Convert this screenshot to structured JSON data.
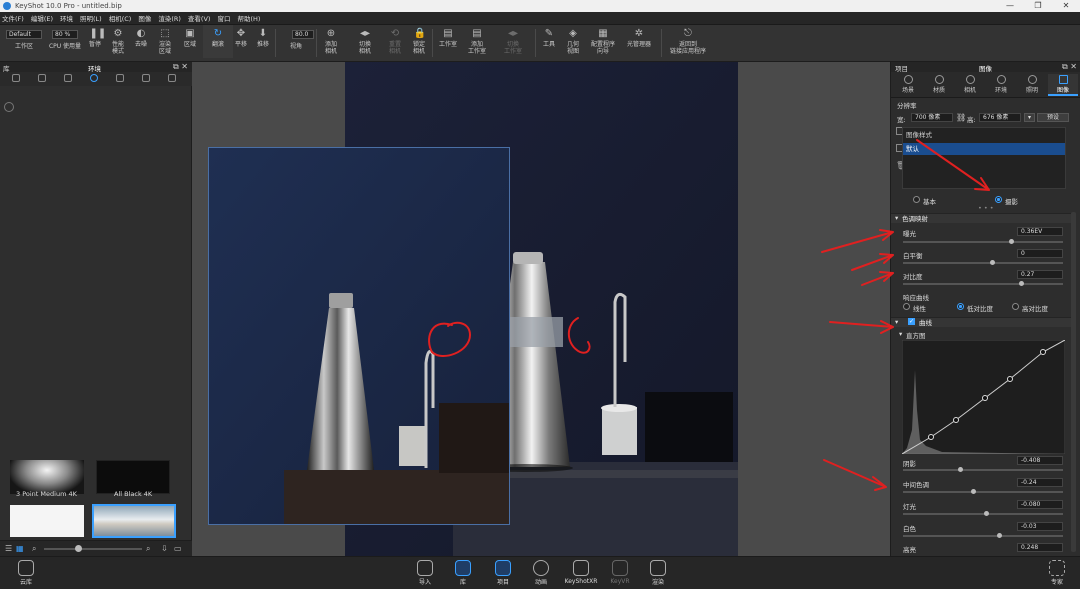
{
  "window": {
    "title": "KeyShot 10.0 Pro  - untitled.bip",
    "controls": [
      "—",
      "❐",
      "✕"
    ]
  },
  "menu": [
    "文件(F)",
    "编辑(E)",
    "环境",
    "照明(L)",
    "相机(C)",
    "图像",
    "渲染(R)",
    "查看(V)",
    "窗口",
    "帮助(H)"
  ],
  "toolbar": {
    "preset": "Default",
    "cpu_pct": "80 %",
    "fov": "80.0",
    "buttons": [
      "工作区",
      "CPU 使用量",
      "暂停",
      "性能\n模式",
      "去噪",
      "渲染\n区域",
      "区域",
      "翻滚",
      "平移",
      "推移",
      "视角",
      "添加\n相机",
      "切换\n相机",
      "重置\n相机",
      "锁定\n相机",
      "工作室",
      "添加\n工作室",
      "切换\n工作室",
      "工具",
      "几何\n视图",
      "配置程序\n向导",
      "光管理器",
      "返回到\n链接应用程序"
    ]
  },
  "left_panel": {
    "title": "库",
    "center_title": "环境",
    "thumbs": [
      {
        "label": "3 Point Medium 4K"
      },
      {
        "label": "All Black 4K"
      }
    ]
  },
  "right_panel": {
    "title": "项目",
    "center_title": "图像",
    "tabs": [
      "场景",
      "材质",
      "相机",
      "环境",
      "照明",
      "图像"
    ],
    "active_tab": "图像",
    "resolution_label": "分辨率",
    "width_label": "宽:",
    "width_value": "700 像素",
    "height_label": "高:",
    "height_value": "676 像素",
    "preset_button": "预设",
    "image_styles": [
      "图像样式",
      "默认"
    ],
    "mode_basic": "基本",
    "mode_photo": "摄影",
    "tone_mapping": "色调映射",
    "exposure_label": "曝光",
    "exposure_value": "0.36EV",
    "exposure_level": 0.68,
    "white_balance_label": "白平衡",
    "white_balance_value": "0",
    "white_balance_level": 0.56,
    "contrast_label": "对比度",
    "contrast_value": "0.27",
    "contrast_level": 0.74,
    "response_curve_label": "响应曲线",
    "curve_linear": "线性",
    "curve_low": "低对比度",
    "curve_high": "高对比度",
    "curves_section": "曲线",
    "histogram_label": "直方图",
    "shadows_label": "阴影",
    "shadows_value": "-0.408",
    "shadows_level": 0.36,
    "midtones_label": "中间色调",
    "midtones_value": "-0.24",
    "midtones_level": 0.44,
    "highlights_label": "灯光",
    "highlights_value": "-0.080",
    "highlights_level": 0.52,
    "whites_label": "白色",
    "whites_value": "-0.03",
    "whites_level": 0.6,
    "highs_label": "高亮",
    "highs_value": "0.248",
    "highs_level": 0.66
  },
  "bottom": {
    "cloud": "云库",
    "buttons": [
      "导入",
      "库",
      "项目",
      "动画",
      "KeyShotXR",
      "KeyVR",
      "渲染"
    ],
    "active": "项目",
    "expert": "专家"
  }
}
